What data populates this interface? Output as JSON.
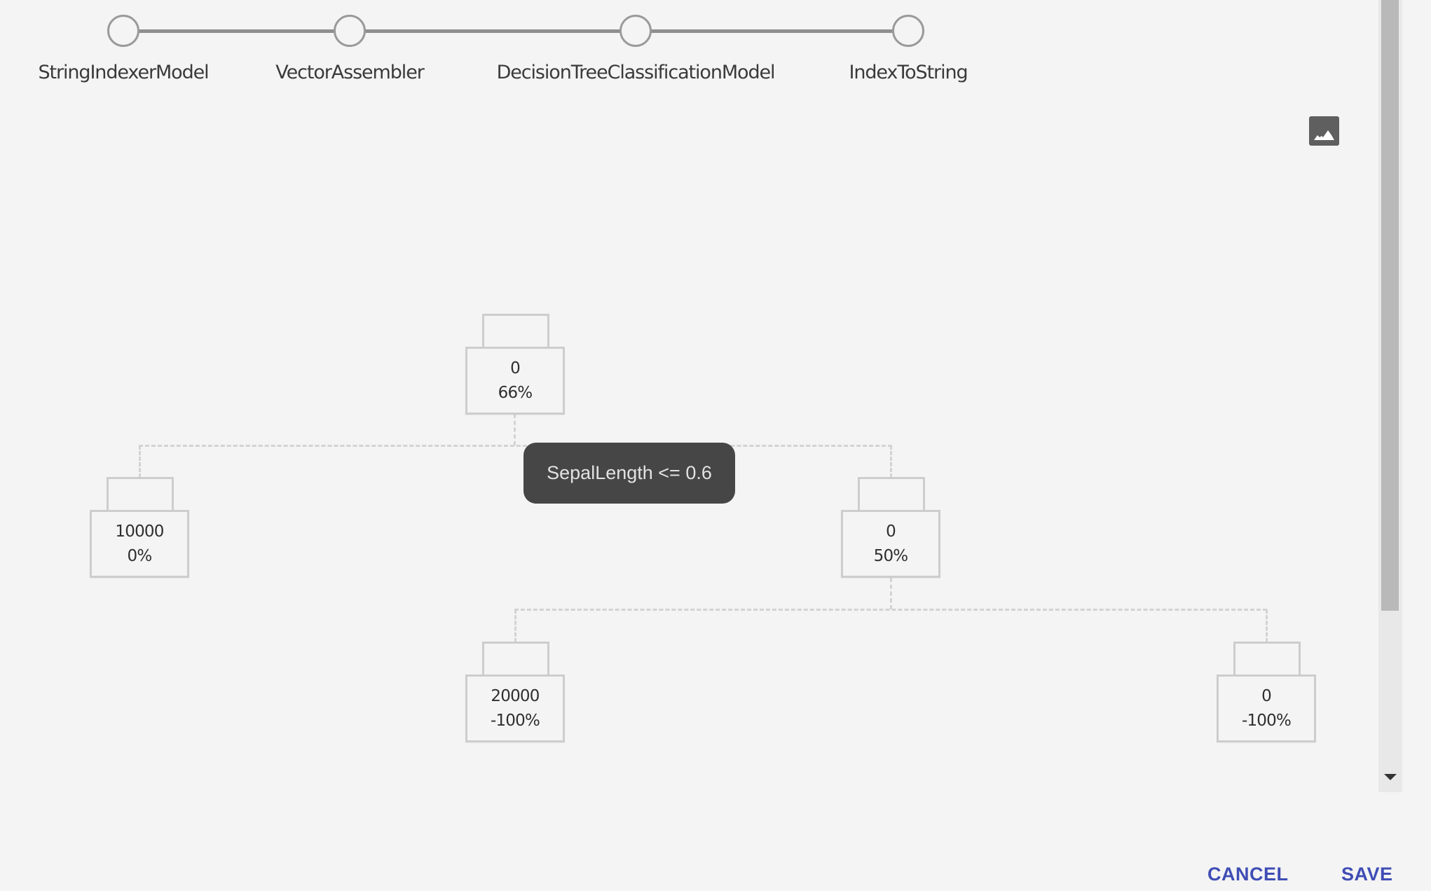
{
  "stepper": {
    "steps": [
      {
        "label": "StringIndexerModel"
      },
      {
        "label": "VectorAssembler"
      },
      {
        "label": "DecisionTreeClassificationModel"
      },
      {
        "label": "IndexToString"
      }
    ]
  },
  "toolbar": {
    "image_icon": "image-icon"
  },
  "tree": {
    "nodes": [
      {
        "id": "root",
        "value": "0",
        "percent": "66%"
      },
      {
        "id": "left",
        "value": "10000",
        "percent": "0%"
      },
      {
        "id": "right",
        "value": "0",
        "percent": "50%"
      },
      {
        "id": "right-left",
        "value": "20000",
        "percent": "-100%"
      },
      {
        "id": "right-right",
        "value": "0",
        "percent": "-100%"
      }
    ],
    "tooltip": "SepalLength <= 0.6"
  },
  "footer": {
    "cancel_label": "CANCEL",
    "save_label": "SAVE"
  },
  "colors": {
    "accent": "#3f4db5",
    "tooltip_bg": "#464646",
    "background": "#f4f4f4"
  }
}
